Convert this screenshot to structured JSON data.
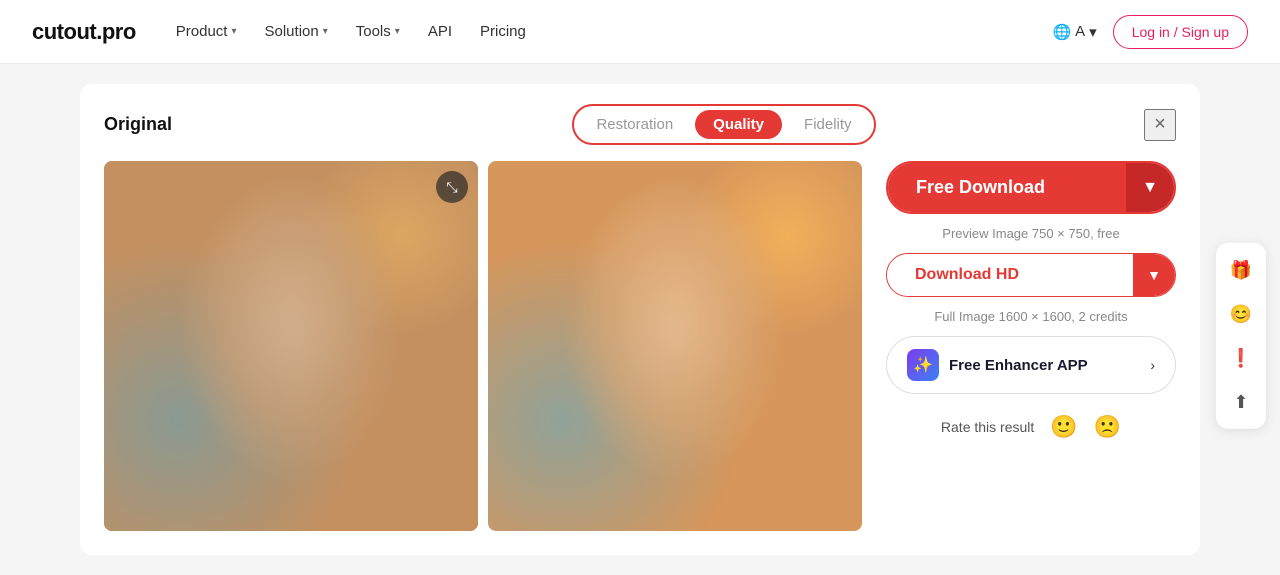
{
  "navbar": {
    "logo": "cutout.pro",
    "links": [
      {
        "label": "Product",
        "hasChevron": true
      },
      {
        "label": "Solution",
        "hasChevron": true
      },
      {
        "label": "Tools",
        "hasChevron": true
      },
      {
        "label": "API",
        "hasChevron": false
      },
      {
        "label": "Pricing",
        "hasChevron": false
      }
    ],
    "lang_label": "A",
    "login_label": "Log in / Sign up"
  },
  "card": {
    "original_label": "Original",
    "close_label": "×",
    "tabs": [
      {
        "label": "Restoration",
        "active": false
      },
      {
        "label": "Quality",
        "active": true
      },
      {
        "label": "Fidelity",
        "active": false
      }
    ],
    "free_download_label": "Free Download",
    "preview_text": "Preview Image 750 × 750, free",
    "download_hd_label": "Download HD",
    "hd_text": "Full Image 1600 × 1600, 2 credits",
    "enhancer_label": "Free Enhancer APP",
    "rate_label": "Rate this result"
  },
  "side_tools": [
    {
      "icon": "🎁",
      "name": "gift"
    },
    {
      "icon": "😊",
      "name": "avatar"
    },
    {
      "icon": "❗",
      "name": "alert"
    },
    {
      "icon": "⬆",
      "name": "upload"
    }
  ]
}
